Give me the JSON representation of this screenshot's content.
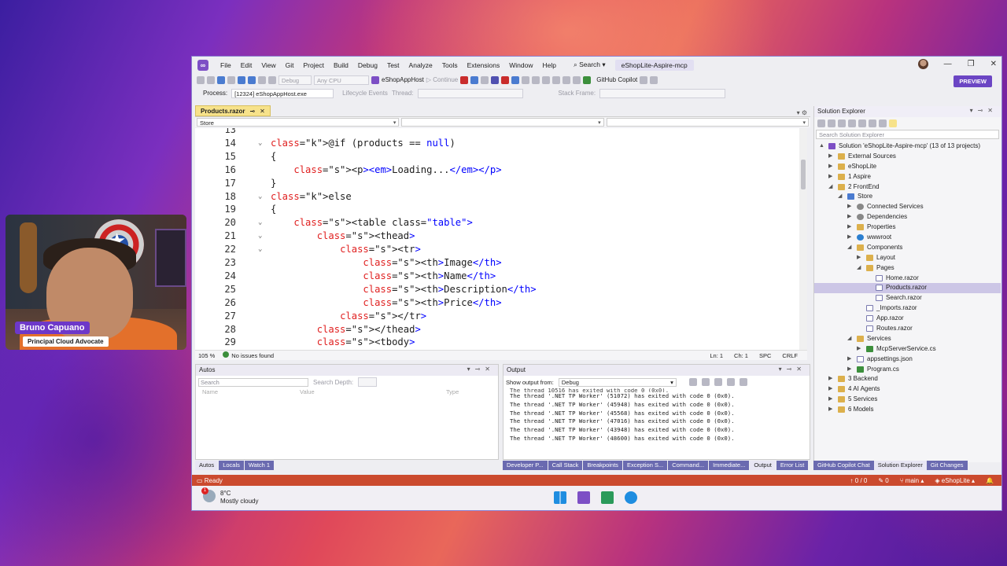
{
  "presenter": {
    "name": "Bruno Capuano",
    "role": "Principal Cloud Advocate"
  },
  "titlebar": {
    "menu": [
      "File",
      "Edit",
      "View",
      "Git",
      "Project",
      "Build",
      "Debug",
      "Test",
      "Analyze",
      "Tools",
      "Extensions",
      "Window",
      "Help"
    ],
    "search_label": "Search",
    "solution_name": "eShopLite-Aspire-mcp"
  },
  "toolbar": {
    "config": "Debug",
    "platform": "Any CPU",
    "startup": "eShopAppHost",
    "continue_label": "Continue",
    "copilot_label": "GitHub Copilot",
    "preview_label": "PREVIEW"
  },
  "procbar": {
    "process_label": "Process:",
    "process_value": "[12324] eShopAppHost.exe",
    "lifecycle_label": "Lifecycle Events",
    "thread_label": "Thread:",
    "stack_label": "Stack Frame:"
  },
  "editor": {
    "tab_name": "Products.razor",
    "nav_left": "Store",
    "zoom": "105 %",
    "issues": "No issues found",
    "ln": "Ln: 1",
    "ch": "Ch: 1",
    "spc": "SPC",
    "crlf": "CRLF",
    "lines": [
      {
        "n": "13",
        "t": ""
      },
      {
        "n": "14",
        "t": "@if (products == null)"
      },
      {
        "n": "15",
        "t": "{"
      },
      {
        "n": "16",
        "t": "    <p><em>Loading...</em></p>"
      },
      {
        "n": "17",
        "t": "}"
      },
      {
        "n": "18",
        "t": "else"
      },
      {
        "n": "19",
        "t": "{"
      },
      {
        "n": "20",
        "t": "    <table class=\"table\">"
      },
      {
        "n": "21",
        "t": "        <thead>"
      },
      {
        "n": "22",
        "t": "            <tr>"
      },
      {
        "n": "23",
        "t": "                <th>Image</th>"
      },
      {
        "n": "24",
        "t": "                <th>Name</th>"
      },
      {
        "n": "25",
        "t": "                <th>Description</th>"
      },
      {
        "n": "26",
        "t": "                <th>Price</th>"
      },
      {
        "n": "27",
        "t": "            </tr>"
      },
      {
        "n": "28",
        "t": "        </thead>"
      },
      {
        "n": "29",
        "t": "        <tbody>"
      }
    ]
  },
  "solution_explorer": {
    "title": "Solution Explorer",
    "search_placeholder": "Search Solution Explorer",
    "tree": [
      {
        "label": "Solution 'eShopLite-Aspire-mcp' (13 of 13 projects)",
        "depth": 0,
        "icon": "sol",
        "arrow": "▲"
      },
      {
        "label": "External Sources",
        "depth": 1,
        "icon": "folder",
        "arrow": "▶"
      },
      {
        "label": "eShopLite",
        "depth": 1,
        "icon": "folder",
        "arrow": "▶"
      },
      {
        "label": "1 Aspire",
        "depth": 1,
        "icon": "folder",
        "arrow": "▶"
      },
      {
        "label": "2 FrontEnd",
        "depth": 1,
        "icon": "folder",
        "arrow": "◢"
      },
      {
        "label": "Store",
        "depth": 2,
        "icon": "proj",
        "arrow": "◢"
      },
      {
        "label": "Connected Services",
        "depth": 3,
        "icon": "gear",
        "arrow": "▶"
      },
      {
        "label": "Dependencies",
        "depth": 3,
        "icon": "gear",
        "arrow": "▶"
      },
      {
        "label": "Properties",
        "depth": 3,
        "icon": "folder",
        "arrow": "▶"
      },
      {
        "label": "wwwroot",
        "depth": 3,
        "icon": "globe",
        "arrow": "▶"
      },
      {
        "label": "Components",
        "depth": 3,
        "icon": "folder",
        "arrow": "◢"
      },
      {
        "label": "Layout",
        "depth": 4,
        "icon": "folder",
        "arrow": "▶"
      },
      {
        "label": "Pages",
        "depth": 4,
        "icon": "folder",
        "arrow": "◢"
      },
      {
        "label": "Home.razor",
        "depth": 5,
        "icon": "file",
        "arrow": ""
      },
      {
        "label": "Products.razor",
        "depth": 5,
        "icon": "file",
        "arrow": "",
        "selected": true
      },
      {
        "label": "Search.razor",
        "depth": 5,
        "icon": "file",
        "arrow": ""
      },
      {
        "label": "_Imports.razor",
        "depth": 4,
        "icon": "file",
        "arrow": ""
      },
      {
        "label": "App.razor",
        "depth": 4,
        "icon": "file",
        "arrow": ""
      },
      {
        "label": "Routes.razor",
        "depth": 4,
        "icon": "file",
        "arrow": ""
      },
      {
        "label": "Services",
        "depth": 3,
        "icon": "folder",
        "arrow": "◢"
      },
      {
        "label": "McpServerService.cs",
        "depth": 4,
        "icon": "cs",
        "arrow": "▶"
      },
      {
        "label": "appsettings.json",
        "depth": 3,
        "icon": "file",
        "arrow": "▶"
      },
      {
        "label": "Program.cs",
        "depth": 3,
        "icon": "cs",
        "arrow": "▶"
      },
      {
        "label": "3 Backend",
        "depth": 1,
        "icon": "folder",
        "arrow": "▶"
      },
      {
        "label": "4 AI Agents",
        "depth": 1,
        "icon": "folder",
        "arrow": "▶"
      },
      {
        "label": "5 Services",
        "depth": 1,
        "icon": "folder",
        "arrow": "▶"
      },
      {
        "label": "6 Models",
        "depth": 1,
        "icon": "folder",
        "arrow": "▶"
      }
    ],
    "tabs": [
      "GitHub Copilot Chat",
      "Solution Explorer",
      "Git Changes"
    ]
  },
  "autos": {
    "title": "Autos",
    "search_placeholder": "Search",
    "depth_label": "Search Depth:",
    "columns": [
      "Name",
      "Value",
      "Type"
    ],
    "tabs": [
      "Autos",
      "Locals",
      "Watch 1"
    ]
  },
  "output": {
    "title": "Output",
    "show_from_label": "Show output from:",
    "source": "Debug",
    "partial_line": "The thread 10516 has exited with code 0 (0x0).",
    "lines": [
      "The thread '.NET TP Worker' (51072) has exited with code 0 (0x0).",
      "The thread '.NET TP Worker' (45948) has exited with code 0 (0x0).",
      "The thread '.NET TP Worker' (45568) has exited with code 0 (0x0).",
      "The thread '.NET TP Worker' (47016) has exited with code 0 (0x0).",
      "The thread '.NET TP Worker' (43948) has exited with code 0 (0x0).",
      "The thread '.NET TP Worker' (48600) has exited with code 0 (0x0)."
    ],
    "tabs": [
      "Developer P...",
      "Call Stack",
      "Breakpoints",
      "Exception S...",
      "Command...",
      "Immediate...",
      "Output",
      "Error List"
    ]
  },
  "statusbar": {
    "ready": "Ready",
    "errors": "0 / 0",
    "pencil": "0",
    "branch": "main",
    "repo": "eShopLite"
  },
  "taskbar": {
    "temp": "8°C",
    "weather": "Mostly cloudy",
    "badge": "1"
  }
}
